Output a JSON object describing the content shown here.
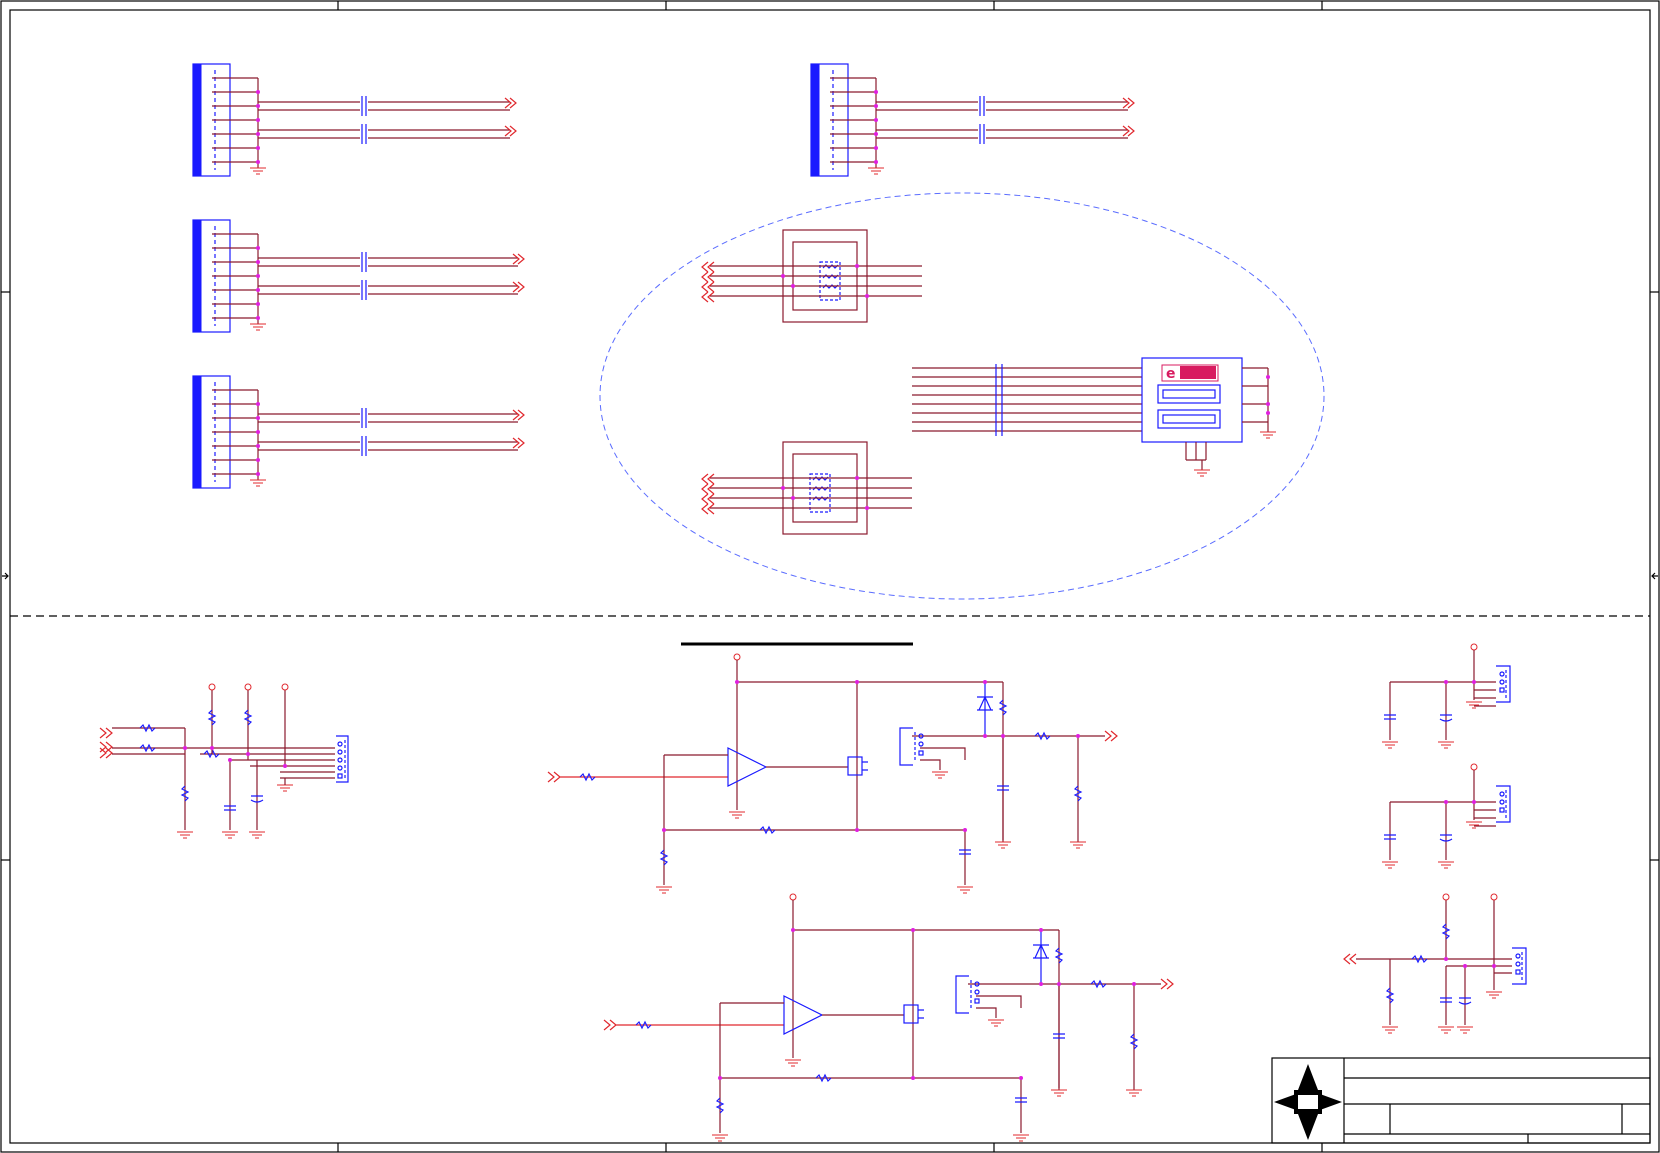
{
  "sheet": {
    "background": "#ffffff",
    "colors": {
      "wire": "#8b1a2e",
      "power": "#e0282e",
      "component": "#1a1aff",
      "junction": "#e020e0",
      "frame": "#000000",
      "group_outline": "#5a6cff"
    },
    "title_block": {
      "logo": "compass-star-logo",
      "title_text": "",
      "sheet_text": ""
    }
  }
}
